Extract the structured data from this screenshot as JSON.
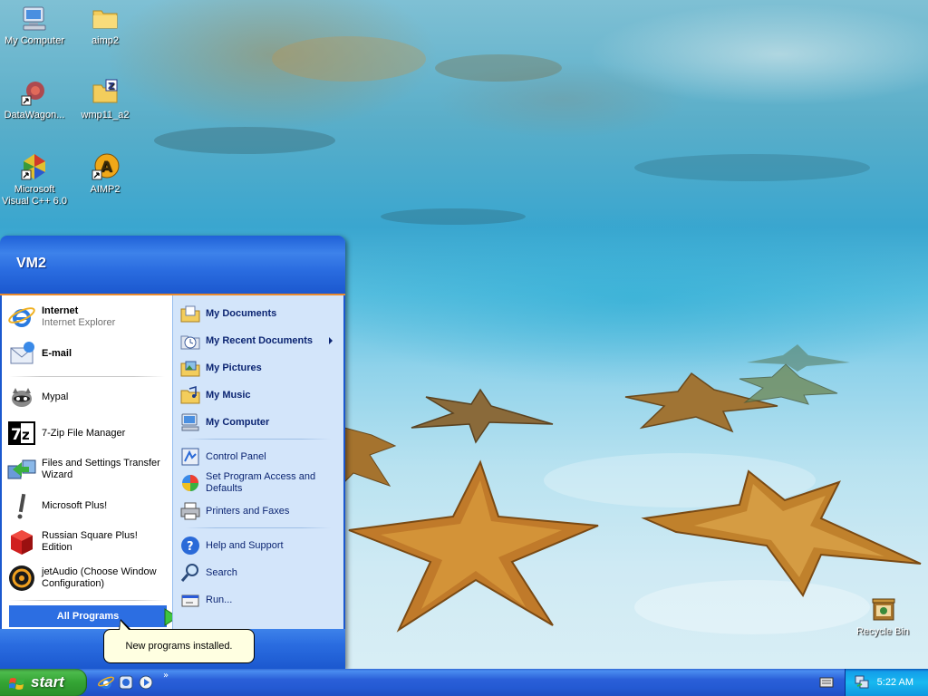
{
  "desktop": {
    "icons": [
      {
        "label": "My Computer",
        "icon": "my-computer-icon"
      },
      {
        "label": "aimp2",
        "icon": "folder-icon"
      },
      {
        "label": "DataWagon...",
        "icon": "datawagon-icon"
      },
      {
        "label": "wmp11_a2",
        "icon": "zip-folder-icon"
      },
      {
        "label": "Microsoft Visual C++ 6.0",
        "icon": "visual-cpp-icon"
      },
      {
        "label": "AIMP2",
        "icon": "aimp2-icon"
      },
      {
        "label": "Recycle Bin",
        "icon": "recycle-bin-icon"
      }
    ]
  },
  "start_menu": {
    "user_name": "VM2",
    "pinned": [
      {
        "title": "Internet",
        "subtitle": "Internet Explorer",
        "icon": "internet-explorer-icon"
      },
      {
        "title": "E-mail",
        "icon": "email-icon"
      }
    ],
    "recent": [
      {
        "label": "Mypal",
        "icon": "mypal-icon"
      },
      {
        "label": "7-Zip File Manager",
        "icon": "7zip-icon"
      },
      {
        "label": "Files and Settings Transfer Wizard",
        "icon": "transfer-wizard-icon"
      },
      {
        "label": "Microsoft Plus!",
        "icon": "microsoft-plus-icon"
      },
      {
        "label": "Russian Square Plus! Edition",
        "icon": "russian-square-icon"
      },
      {
        "label": "jetAudio (Choose Window Configuration)",
        "icon": "jetaudio-icon"
      }
    ],
    "all_programs_label": "All Programs",
    "right_column": {
      "places": [
        {
          "label": "My Documents",
          "icon": "my-documents-icon"
        },
        {
          "label": "My Recent Documents",
          "icon": "recent-documents-icon"
        },
        {
          "label": "My Pictures",
          "icon": "my-pictures-icon"
        },
        {
          "label": "My Music",
          "icon": "my-music-icon"
        },
        {
          "label": "My Computer",
          "icon": "my-computer-icon"
        }
      ],
      "settings": [
        {
          "label": "Control Panel",
          "icon": "control-panel-icon"
        },
        {
          "label": "Set Program Access and Defaults",
          "icon": "program-access-icon"
        },
        {
          "label": "Printers and Faxes",
          "icon": "printer-icon"
        }
      ],
      "tools": [
        {
          "label": "Help and Support",
          "icon": "help-icon"
        },
        {
          "label": "Search",
          "icon": "search-icon"
        },
        {
          "label": "Run...",
          "icon": "run-icon"
        }
      ]
    }
  },
  "balloon": {
    "text": "New programs installed."
  },
  "taskbar": {
    "start_label": "start",
    "quick_launch_chevron": "»",
    "clock": "5:22 AM"
  },
  "colors": {
    "start_header": "#2a6ce0",
    "start_right_panel": "#d3e5fa",
    "start_button_green": "#34a434",
    "taskbar_blue": "#245ad3",
    "tray_blue": "#18b9f0"
  }
}
